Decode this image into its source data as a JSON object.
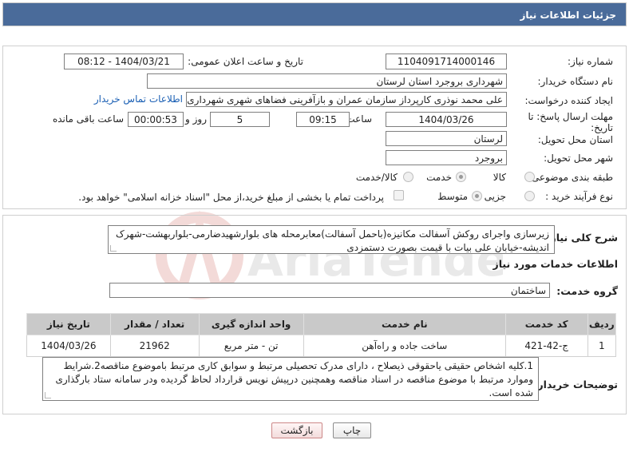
{
  "header": {
    "title": "جزئیات اطلاعات نیاز"
  },
  "fields": {
    "need_number_label": "شماره نیاز:",
    "need_number": "1104091714000146",
    "announce_label": "تاریخ و ساعت اعلان عمومی:",
    "announce_value": "1404/03/21 - 08:12",
    "buyer_org_label": "نام دستگاه خریدار:",
    "buyer_org": "شهرداری بروجرد استان لرستان",
    "creator_label": "ایجاد کننده درخواست:",
    "creator": "علی محمد نوذری کارپرداز سازمان عمران و بازآفرینی فضاهای شهری شهرداری بر",
    "contact_link": "اطلاعات تماس خریدار",
    "deadline_label_1": "مهلت ارسال پاسخ: تا",
    "deadline_label_2": "تاریخ:",
    "deadline_date": "1404/03/26",
    "time_label": "ساعت",
    "deadline_time": "09:15",
    "days_value": "5",
    "days_label": "روز و",
    "remaining_time": "00:00:53",
    "remaining_label": "ساعت باقی مانده",
    "province_label": "استان محل تحویل:",
    "province": "لرستان",
    "city_label": "شهر محل تحویل:",
    "city": "بروجرد",
    "category_label": "طبقه بندی موضوعی:",
    "category_options": [
      "کالا",
      "خدمت",
      "کالا/خدمت"
    ],
    "category_selected": "خدمت",
    "process_label": "نوع فرآیند خرید :",
    "process_options": [
      "جزیی",
      "متوسط"
    ],
    "process_selected": "متوسط",
    "payment_note": "پرداخت تمام یا بخشی از مبلغ خرید،از محل \"اسناد خزانه اسلامی\" خواهد بود."
  },
  "description": {
    "label": "شرح کلی نیاز:",
    "text": "زیرسازی واجرای روکش آسفالت مکانیزه(باحمل آسفالت)معابرمحله های بلوارشهیدضارمی-بلواربهشت-شهرک اندیشه-خیابان علی بیات با قیمت بصورت دستمزدی"
  },
  "services": {
    "section_title": "اطلاعات خدمات مورد نیاز",
    "group_label": "گروه خدمت:",
    "group_value": "ساختمان",
    "columns": [
      "ردیف",
      "کد خدمت",
      "نام خدمت",
      "واحد اندازه گیری",
      "تعداد / مقدار",
      "تاریخ نیاز"
    ],
    "rows": [
      [
        "1",
        "ج-42-421",
        "ساخت جاده و راه‌آهن",
        "تن - متر مربع",
        "21962",
        "1404/03/26"
      ]
    ]
  },
  "buyer_notes": {
    "label": "توضیحات خریدار:",
    "text": "1.کلیه اشخاص حقیقی یاحقوقی ذیصلاح ، دارای مدرک تحصیلی مرتبط و سوابق کاری مرتبط باموضوع مناقصه2.شرایط وموارد مرتبط با موضوع مناقصه در اسناد مناقصه وهمچنین درپیش نویس قرارداد لحاظ گردیده ودر سامانه ستاد بارگذاری شده است."
  },
  "buttons": {
    "print": "چاپ",
    "back": "بازگشت"
  },
  "watermark": {
    "text": "AriaTender.neT"
  },
  "colors": {
    "header_bg": "#4a6b9a",
    "link": "#1a5fb4",
    "table_header": "#c9c9c9"
  }
}
